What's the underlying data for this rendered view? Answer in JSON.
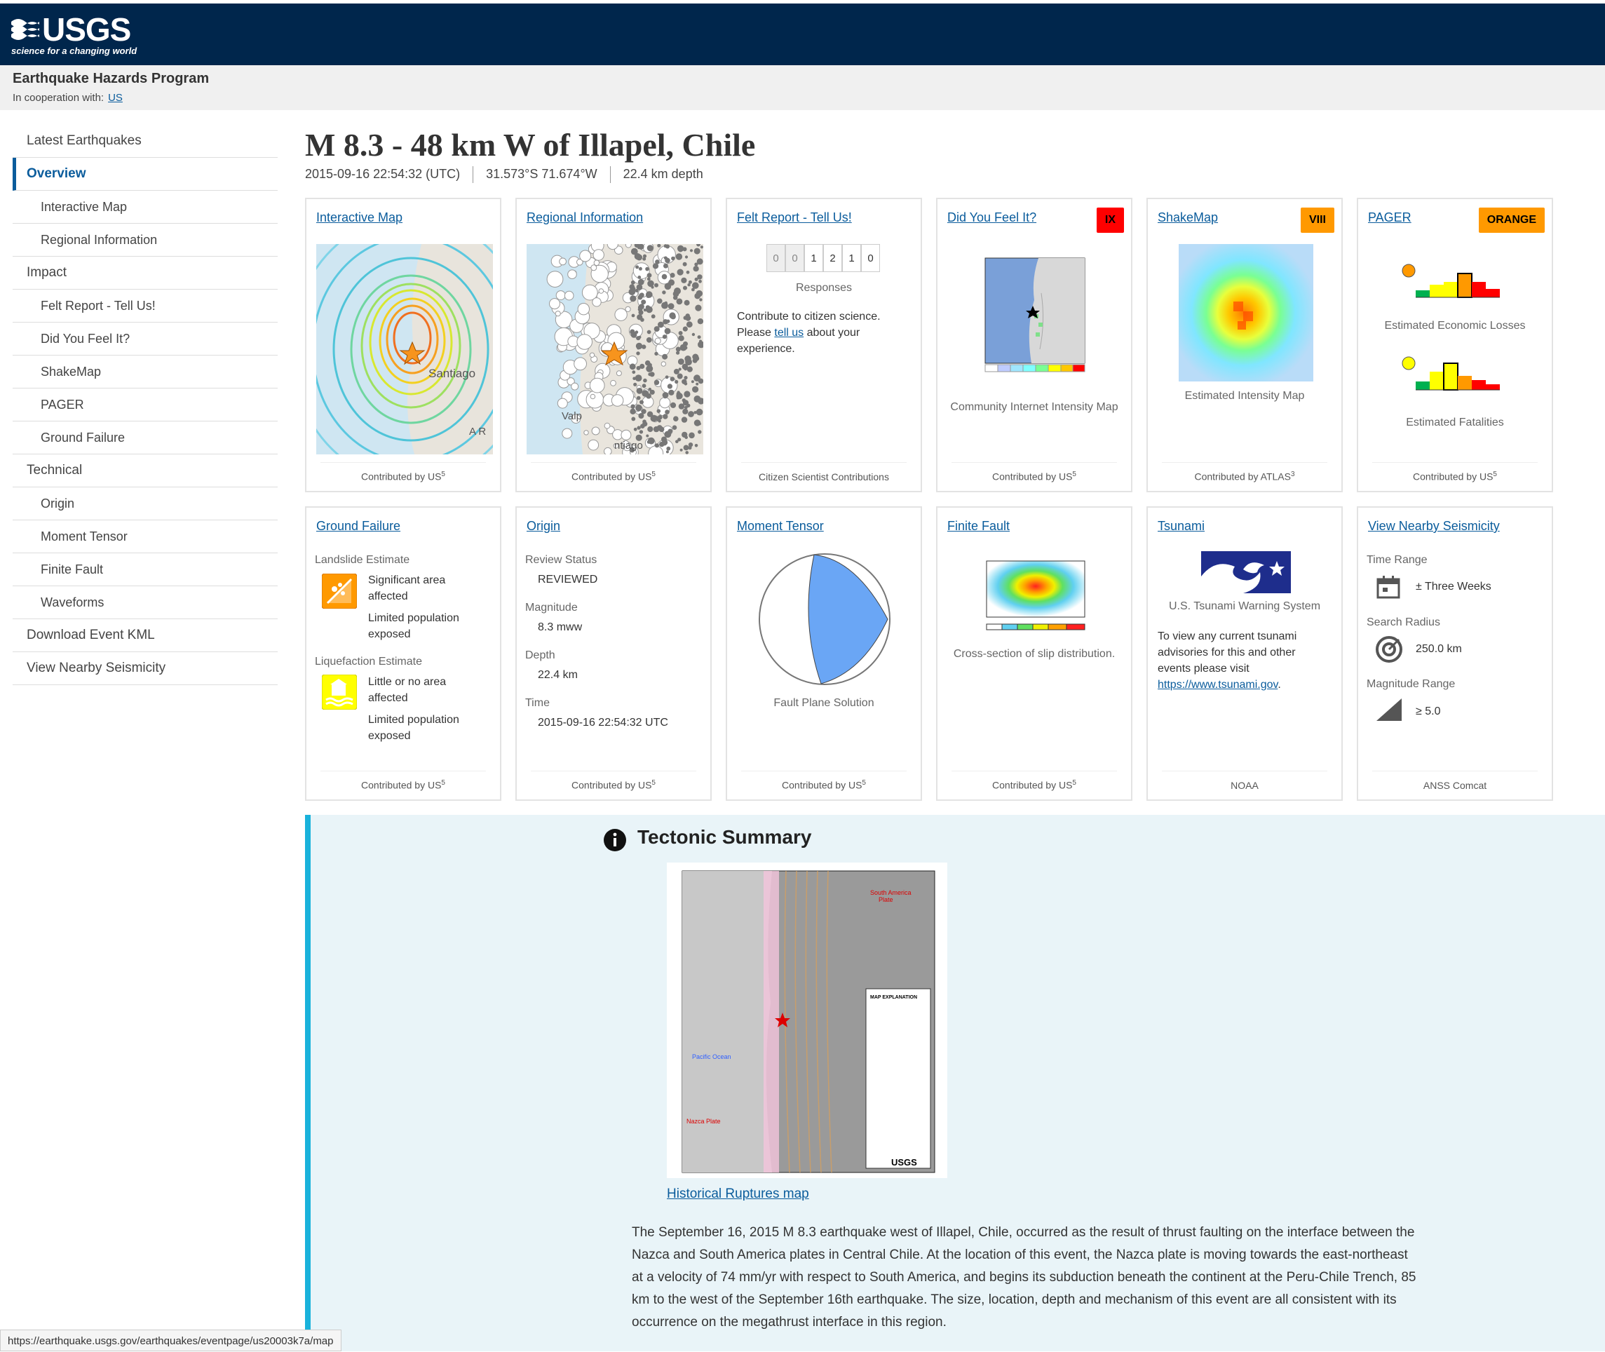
{
  "header": {
    "logo_text": "USGS",
    "logo_tagline": "science for a changing world",
    "program": "Earthquake Hazards Program",
    "coop_label": "In cooperation with:",
    "coop_link": "US"
  },
  "nav": {
    "items": [
      {
        "label": "Latest Earthquakes"
      },
      {
        "label": "Overview"
      },
      {
        "label": "Interactive Map"
      },
      {
        "label": "Regional Information"
      },
      {
        "label": "Impact"
      },
      {
        "label": "Felt Report - Tell Us!"
      },
      {
        "label": "Did You Feel It?"
      },
      {
        "label": "ShakeMap"
      },
      {
        "label": "PAGER"
      },
      {
        "label": "Ground Failure"
      },
      {
        "label": "Technical"
      },
      {
        "label": "Origin"
      },
      {
        "label": "Moment Tensor"
      },
      {
        "label": "Finite Fault"
      },
      {
        "label": "Waveforms"
      },
      {
        "label": "Download Event KML"
      },
      {
        "label": "View Nearby Seismicity"
      }
    ]
  },
  "event": {
    "title": "M 8.3 - 48 km W of Illapel, Chile",
    "time": "2015-09-16 22:54:32 (UTC)",
    "coords": "31.573°S 71.674°W",
    "depth": "22.4 km depth"
  },
  "cards": {
    "interactive_map": {
      "title": "Interactive Map",
      "contrib": "Contributed by US",
      "sup": "5",
      "map_label": "Santiago",
      "map_label2": "A R"
    },
    "regional": {
      "title": "Regional Information",
      "contrib": "Contributed by US",
      "sup": "5",
      "lbl1": "Valp",
      "lbl2": "ntiago"
    },
    "felt": {
      "title": "Felt Report - Tell Us!",
      "digits": [
        "0",
        "0",
        "1",
        "2",
        "1",
        "0"
      ],
      "responses": "Responses",
      "text1": "Contribute to citizen science.",
      "text2a": "Please ",
      "text2b": "tell us",
      "text2c": " about your",
      "text3": "experience.",
      "contrib": "Citizen Scientist Contributions"
    },
    "dyfi": {
      "title": "Did You Feel It?",
      "badge": "IX",
      "badge_color": "#ff0000",
      "caption": "Community Internet Intensity Map",
      "contrib": "Contributed by US",
      "sup": "5"
    },
    "shakemap": {
      "title": "ShakeMap",
      "badge": "VIII",
      "badge_color": "#ff9900",
      "caption": "Estimated Intensity Map",
      "contrib": "Contributed by ATLAS",
      "sup": "3"
    },
    "pager": {
      "title": "PAGER",
      "badge": "ORANGE",
      "badge_color": "#ff9900",
      "cap1": "Estimated Economic Losses",
      "cap2": "Estimated Fatalities",
      "contrib": "Contributed by US",
      "sup": "5"
    },
    "ground": {
      "title": "Ground Failure",
      "ls_label": "Landslide Estimate",
      "ls1": "Significant area",
      "ls2": "affected",
      "ls3": "Limited population",
      "ls4": "exposed",
      "lq_label": "Liquefaction Estimate",
      "lq1": "Little or no area",
      "lq2": "affected",
      "lq3": "Limited population",
      "lq4": "exposed",
      "contrib": "Contributed by US",
      "sup": "5"
    },
    "origin": {
      "title": "Origin",
      "review_label": "Review Status",
      "review": "REVIEWED",
      "mag_label": "Magnitude",
      "mag": "8.3 mww",
      "depth_label": "Depth",
      "depth": "22.4 km",
      "time_label": "Time",
      "time": "2015-09-16 22:54:32 UTC",
      "contrib": "Contributed by US",
      "sup": "5"
    },
    "tensor": {
      "title": "Moment Tensor",
      "caption": "Fault Plane Solution",
      "contrib": "Contributed by US",
      "sup": "5"
    },
    "finite": {
      "title": "Finite Fault",
      "caption": "Cross-section of slip distribution.",
      "contrib": "Contributed by US",
      "sup": "5"
    },
    "tsunami": {
      "title": "Tsunami",
      "caption": "U.S. Tsunami Warning System",
      "t1": "To view any current tsunami",
      "t2": "advisories for this and other",
      "t3": "events please visit",
      "link": "https://www.tsunami.gov",
      "dot": ".",
      "contrib": "NOAA"
    },
    "nearby": {
      "title": "View Nearby Seismicity",
      "tr_label": "Time Range",
      "tr": "± Three Weeks",
      "sr_label": "Search Radius",
      "sr": "250.0 km",
      "mr_label": "Magnitude Range",
      "mr": "≥ 5.0",
      "contrib": "ANSS Comcat"
    }
  },
  "tectonic": {
    "title": "Tectonic Summary",
    "link": "Historical Ruptures map",
    "map_labels": {
      "sa": "South America",
      "sa2": "Plate",
      "po": "Pacific Ocean",
      "np": "Nazca Plate",
      "logo": "USGS",
      "legend": "MAP EXPLANATION"
    },
    "text": "The September 16, 2015 M 8.3 earthquake west of Illapel, Chile, occurred as the result of thrust faulting on the interface between the Nazca and South America plates in Central Chile. At the location of this event, the Nazca plate is moving towards the east-northeast at a velocity of 74 mm/yr with respect to South America, and begins its subduction beneath the continent at the Peru-Chile Trench, 85 km to the west of the September 16th earthquake. The size, location, depth and mechanism of this event are all consistent with its occurrence on the megathrust interface in this region."
  },
  "status_url": "https://earthquake.usgs.gov/earthquakes/eventpage/us20003k7a/map",
  "colors": {
    "header": "#00264c",
    "link": "#0a5c9c",
    "accent": "#19b2db"
  }
}
